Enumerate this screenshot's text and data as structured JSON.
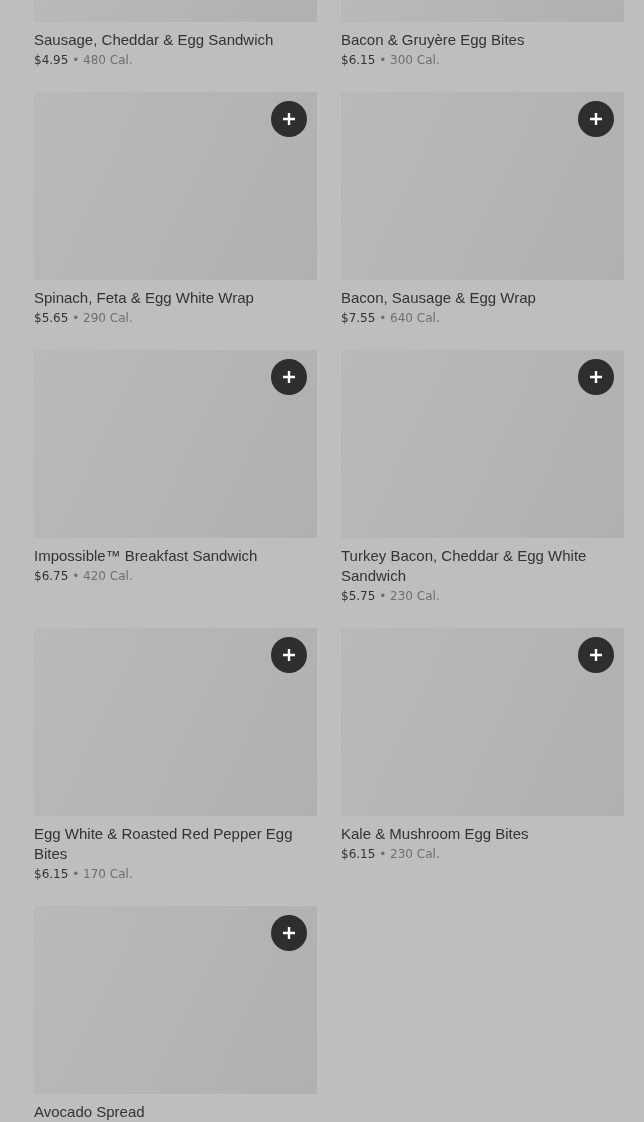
{
  "separator": "•",
  "items": [
    {
      "name": "Sausage, Cheddar & Egg Sandwich",
      "price": "$4.95",
      "calories": "480 Cal."
    },
    {
      "name": "Bacon & Gruyère Egg Bites",
      "price": "$6.15",
      "calories": "300 Cal."
    },
    {
      "name": "Spinach, Feta & Egg White Wrap",
      "price": "$5.65",
      "calories": "290 Cal.",
      "add_button": true
    },
    {
      "name": "Bacon, Sausage & Egg Wrap",
      "price": "$7.55",
      "calories": "640 Cal.",
      "add_button": true
    },
    {
      "name": "Impossible™ Breakfast Sandwich",
      "price": "$6.75",
      "calories": "420 Cal.",
      "add_button": true
    },
    {
      "name": "Turkey Bacon, Cheddar & Egg White Sandwich",
      "price": "$5.75",
      "calories": "230 Cal.",
      "add_button": true
    },
    {
      "name": "Egg White & Roasted Red Pepper Egg Bites",
      "price": "$6.15",
      "calories": "170 Cal.",
      "add_button": true
    },
    {
      "name": "Kale & Mushroom Egg Bites",
      "price": "$6.15",
      "calories": "230 Cal.",
      "add_button": true
    },
    {
      "name": "Avocado Spread",
      "add_button": true
    }
  ]
}
